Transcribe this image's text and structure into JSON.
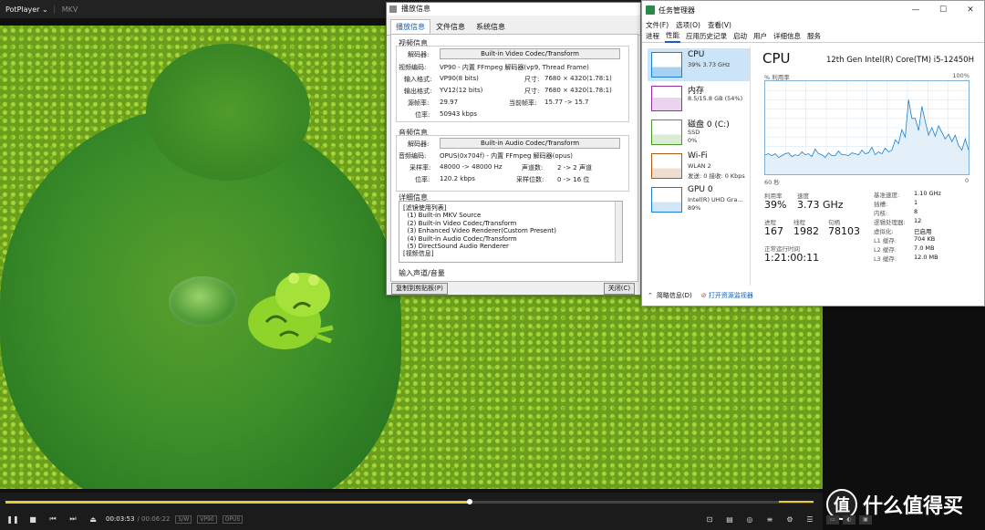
{
  "potplayer": {
    "app_title": "PotPlayer",
    "menu_arrow": "⌄",
    "tab": "MKV",
    "time_current": "00:03:53",
    "time_total": "/ 00:06:22",
    "badges": [
      "S/W",
      "VP90",
      "OPUS"
    ],
    "progress": 0.575,
    "volume": 1.0
  },
  "info_dialog": {
    "title": "播放信息",
    "tabs": [
      "播放信息",
      "文件信息",
      "系统信息"
    ],
    "video_section": "视频信息",
    "decoder_label": "解码器:",
    "video_decoder": "Built-in Video Codec/Transform",
    "rows_video": [
      {
        "k": "视频编码:",
        "v": "VP90 - 内置 FFmpeg 解码器(vp9, Thread Frame)"
      },
      {
        "k": "输入格式:",
        "v": "VP90(8 bits)",
        "k2": "尺寸:",
        "v2": "7680 × 4320(1.78:1)"
      },
      {
        "k": "输出格式:",
        "v": "YV12(12 bits)",
        "k2": "尺寸:",
        "v2": "7680 × 4320(1.78:1)"
      },
      {
        "k": "源帧率:",
        "v": "29.97",
        "k2": "当前帧率:",
        "v2": "15.77 -> 15.7"
      },
      {
        "k": "位率:",
        "v": "50943 kbps"
      }
    ],
    "audio_section": "音频信息",
    "audio_decoder": "Built-in Audio Codec/Transform",
    "rows_audio": [
      {
        "k": "音频编码:",
        "v": "OPUS(0x704f) - 内置 FFmpeg 解码器(opus)"
      },
      {
        "k": "采样率:",
        "v": "48000 -> 48000 Hz",
        "k2": "声道数:",
        "v2": "2 -> 2 声道"
      },
      {
        "k": "位率:",
        "v": "120.2 kbps",
        "k2": "采样位数:",
        "v2": "0 -> 16 位"
      }
    ],
    "detail_section": "详细信息",
    "detail_lines": [
      "[滤镜使用列表]",
      "  (1) Built-in MKV Source",
      "  (2) Built-in Video Codec/Transform",
      "  (3) Enhanced Video Renderer(Custom Present)",
      "  (4) Built-in Audio Codec/Transform",
      "  (5) DirectSound Audio Renderer",
      "",
      "[视频信息]"
    ],
    "input_section": "输入声道/音量",
    "copy_button": "复制到剪贴板(P)",
    "close_button": "关闭(C)"
  },
  "task_manager": {
    "title": "任务管理器",
    "window_buttons": [
      "—",
      "☐",
      "✕"
    ],
    "menu": [
      "文件(F)",
      "选项(O)",
      "查看(V)"
    ],
    "tabs": [
      "进程",
      "性能",
      "应用历史记录",
      "启动",
      "用户",
      "详细信息",
      "服务"
    ],
    "resources": [
      {
        "name": "CPU",
        "sub": "39%  3.73 GHz",
        "sub2": "",
        "color": "#1a7fd0"
      },
      {
        "name": "内存",
        "sub": "8.5/15.8 GB (54%)",
        "sub2": "",
        "color": "#9a2da8"
      },
      {
        "name": "磁盘 0 (C:)",
        "sub": "SSD",
        "sub2": "0%",
        "color": "#4a9a2a"
      },
      {
        "name": "Wi-Fi",
        "sub": "WLAN 2",
        "sub2": "发送: 0 接收: 0 Kbps",
        "color": "#a85a1a"
      },
      {
        "name": "GPU 0",
        "sub": "Intel(R) UHD Gra...",
        "sub2": "89%",
        "color": "#1a7fd0"
      }
    ],
    "heading": "CPU",
    "model": "12th Gen Intel(R) Core(TM) i5-12450H",
    "util_label": "% 利用率",
    "util_max": "100%",
    "x_left": "60 秒",
    "x_right": "0",
    "cpu_series": [
      21,
      22,
      20,
      22,
      18,
      20,
      22,
      23,
      19,
      21,
      20,
      24,
      21,
      22,
      19,
      27,
      22,
      21,
      18,
      23,
      20,
      20,
      25,
      21,
      21,
      20,
      23,
      22,
      21,
      26,
      22,
      23,
      29,
      21,
      24,
      22,
      28,
      24,
      26,
      37,
      33,
      48,
      40,
      80,
      60,
      60,
      47,
      73,
      57,
      42,
      50,
      41,
      52,
      45,
      38,
      43,
      35,
      42,
      31,
      26,
      38,
      26
    ],
    "stats_labels": [
      "利用率",
      "速度",
      "进程",
      "线程",
      "句柄",
      "正常运行时间"
    ],
    "stats_values": {
      "util": "39%",
      "speed": "3.73 GHz",
      "proc": "167",
      "threads": "1982",
      "handles": "78103",
      "uptime": "1:21:00:11"
    },
    "specs": [
      {
        "k": "基准速度:",
        "v": "1.10 GHz"
      },
      {
        "k": "插槽:",
        "v": "1"
      },
      {
        "k": "内核:",
        "v": "8"
      },
      {
        "k": "逻辑处理器:",
        "v": "12"
      },
      {
        "k": "虚拟化:",
        "v": "已启用"
      },
      {
        "k": "L1 缓存:",
        "v": "704 KB"
      },
      {
        "k": "L2 缓存:",
        "v": "7.0 MB"
      },
      {
        "k": "L3 缓存:",
        "v": "12.0 MB"
      }
    ],
    "footer_brief": "简略信息(D)",
    "footer_link": "打开资源监视器"
  },
  "watermark": {
    "logo_char": "值",
    "text": "什么值得买"
  }
}
